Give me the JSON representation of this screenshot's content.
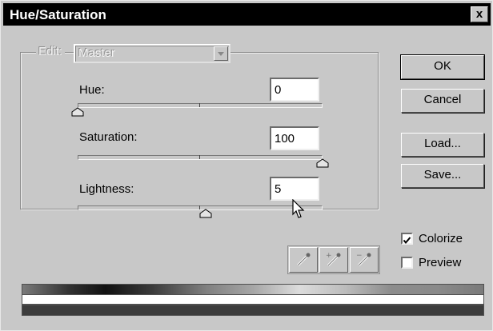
{
  "window": {
    "title": "Hue/Saturation",
    "close_glyph": "x"
  },
  "edit": {
    "label": "Edit:",
    "value": "Master"
  },
  "sliders": {
    "hue": {
      "label": "Hue:",
      "value": "0"
    },
    "saturation": {
      "label": "Saturation:",
      "value": "100"
    },
    "lightness": {
      "label": "Lightness:",
      "value": "5"
    }
  },
  "buttons": {
    "ok": "OK",
    "cancel": "Cancel",
    "load": "Load...",
    "save": "Save..."
  },
  "options": {
    "colorize": {
      "label": "Colorize",
      "checked": true
    },
    "preview": {
      "label": "Preview",
      "checked": false
    }
  },
  "eyedroppers": [
    "eyedropper-icon",
    "eyedropper-plus-icon",
    "eyedropper-minus-icon"
  ],
  "icons": {
    "check": "checkmark-icon",
    "cursor": "mouse-pointer-icon",
    "dropdown": "chevron-down-icon"
  },
  "colors": {
    "title_bg": "#000000",
    "dialog_bg": "#c8c8c8"
  }
}
